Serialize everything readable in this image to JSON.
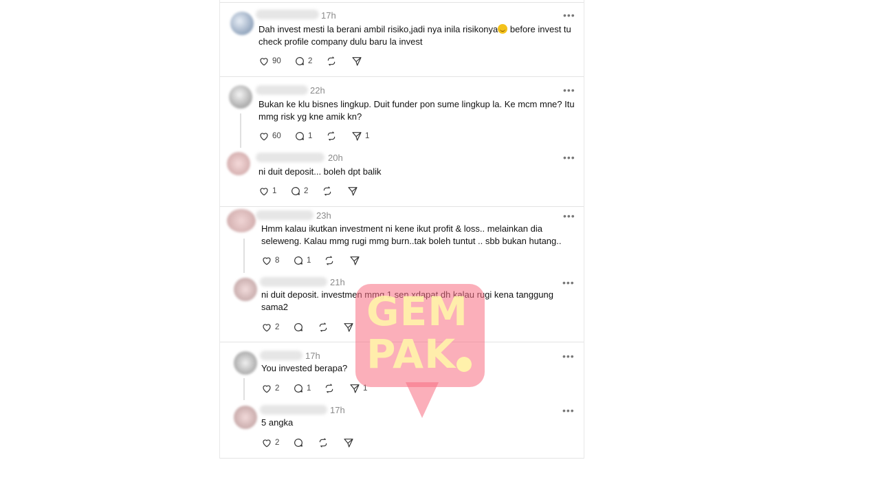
{
  "posts": [
    {
      "time": "17h",
      "text": "Dah invest mesti la berani ambil risiko,jadi nya inila risikonya",
      "text_tail": " before invest tu check profile company dulu baru la invest",
      "likes": "90",
      "replies": "2",
      "reposts": "",
      "shares": ""
    },
    {
      "time": "22h",
      "text": "Bukan ke klu bisnes lingkup. Duit funder pon sume lingkup la. Ke mcm mne? Itu mmg risk yg kne amik kn?",
      "likes": "60",
      "replies": "1",
      "reposts": "",
      "shares": "1"
    },
    {
      "time": "20h",
      "text": "ni duit deposit... boleh dpt balik",
      "likes": "1",
      "replies": "2",
      "reposts": "",
      "shares": ""
    },
    {
      "time": "23h",
      "text": "Hmm kalau ikutkan investment ni kene ikut profit & loss.. melainkan dia seleweng. Kalau mmg rugi mmg burn..tak boleh tuntut .. sbb bukan hutang..",
      "likes": "8",
      "replies": "1",
      "reposts": "",
      "shares": ""
    },
    {
      "time": "21h",
      "text": "ni duit deposit. investmen mmg 1 sen xdapat dh kalau rugi kena tanggung sama2",
      "likes": "2",
      "replies": "",
      "reposts": "",
      "shares": ""
    },
    {
      "time": "17h",
      "text": "You invested berapa?",
      "likes": "2",
      "replies": "1",
      "reposts": "",
      "shares": "1"
    },
    {
      "time": "17h",
      "text": "5 angka",
      "likes": "2",
      "replies": "",
      "reposts": "",
      "shares": ""
    }
  ],
  "watermark": {
    "line1": "GEM",
    "line2": "PAK",
    "color": "#f86e82"
  }
}
